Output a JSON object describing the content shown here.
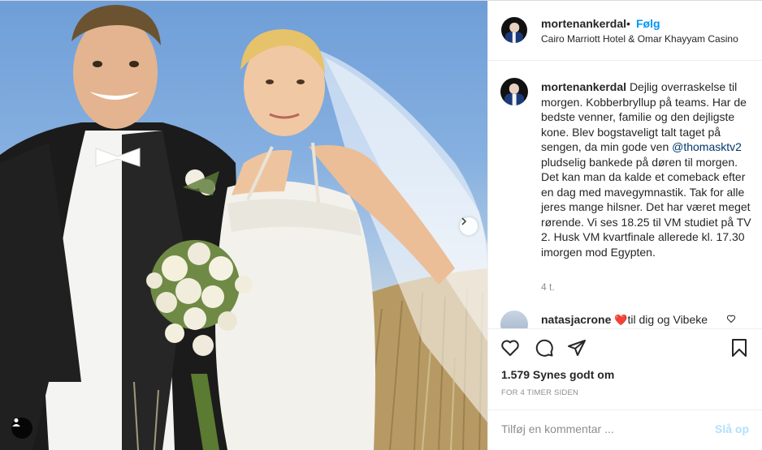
{
  "post": {
    "header": {
      "username": "mortenankerdal",
      "separator": "•",
      "follow_label": "Følg",
      "location": "Cairo Marriott Hotel & Omar Khayyam Casino"
    },
    "caption": {
      "username": "mortenankerdal",
      "text_before_mention": "Dejlig overraskelse til morgen. Kobberbryllup på teams. Har de bedste venner, familie og den dejligste kone. Blev bogstaveligt talt taget på sengen, da min gode ven ",
      "mention": "@thomasktv2",
      "text_after_mention": " pludselig bankede på døren til morgen. Det kan man da kalde et comeback efter en dag med mavegymnastik. Tak for alle jeres mange hilsner. Det har været meget rørende. Vi ses 18.25 til VM studiet på TV 2. Husk VM kvartfinale allerede kl. 17.30 imorgen mod Egypten.",
      "time": "4 t."
    },
    "first_comment": {
      "username": "natasjacrone",
      "text": "til dig og Vibeke",
      "emoji": "heart"
    },
    "actions": {
      "like_icon": "heart-icon",
      "comment_icon": "comment-icon",
      "share_icon": "paper-plane-icon",
      "save_icon": "bookmark-icon"
    },
    "likes": "1.579 Synes godt om",
    "timestamp": "FOR 4 TIMER SIDEN",
    "add_comment": {
      "placeholder": "Tilføj en kommentar ...",
      "post_label": "Slå op"
    }
  },
  "photo": {
    "description_icons": [
      "user-tag-icon",
      "chevron-right-icon"
    ]
  },
  "colors": {
    "accent": "#0095f6",
    "mention": "#00376b",
    "muted": "#8e8e8e",
    "post_disabled": "#b2dffc",
    "heart": "#ed4956"
  }
}
